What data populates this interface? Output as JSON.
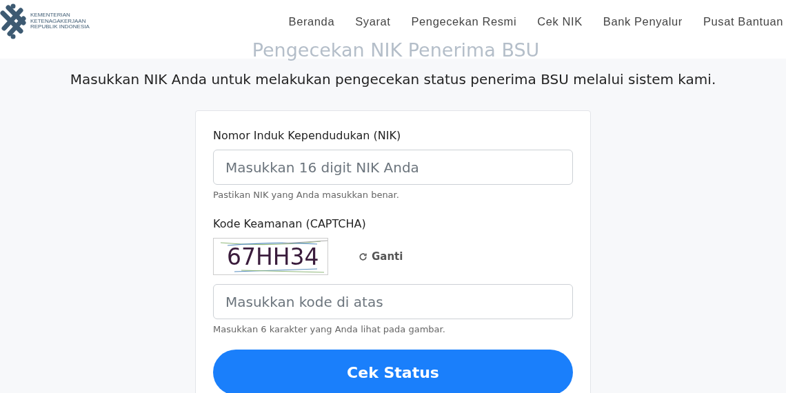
{
  "logo": {
    "lines": [
      "KEMENTERIAN",
      "KETENAGAKERJAAN",
      "REPUBLIK INDONESIA"
    ]
  },
  "nav": [
    {
      "label": "Beranda"
    },
    {
      "label": "Syarat"
    },
    {
      "label": "Pengecekan Resmi"
    },
    {
      "label": "Cek NIK"
    },
    {
      "label": "Bank Penyalur"
    },
    {
      "label": "Pusat Bantuan"
    }
  ],
  "heading": "Pengecekan NIK Penerima BSU",
  "intro": "Masukkan NIK Anda untuk melakukan pengecekan status penerima BSU melalui sistem kami.",
  "form": {
    "nik_label": "Nomor Induk Kependudukan (NIK)",
    "nik_placeholder": "Masukkan 16 digit NIK Anda",
    "nik_help": "Pastikan NIK yang Anda masukkan benar.",
    "captcha_label": "Kode Keamanan (CAPTCHA)",
    "captcha_text": "67HH34",
    "refresh": "Ganti",
    "code_placeholder": "Masukkan kode di atas",
    "code_help": "Masukkan 6 karakter yang Anda lihat pada gambar.",
    "submit": "Cek Status"
  }
}
